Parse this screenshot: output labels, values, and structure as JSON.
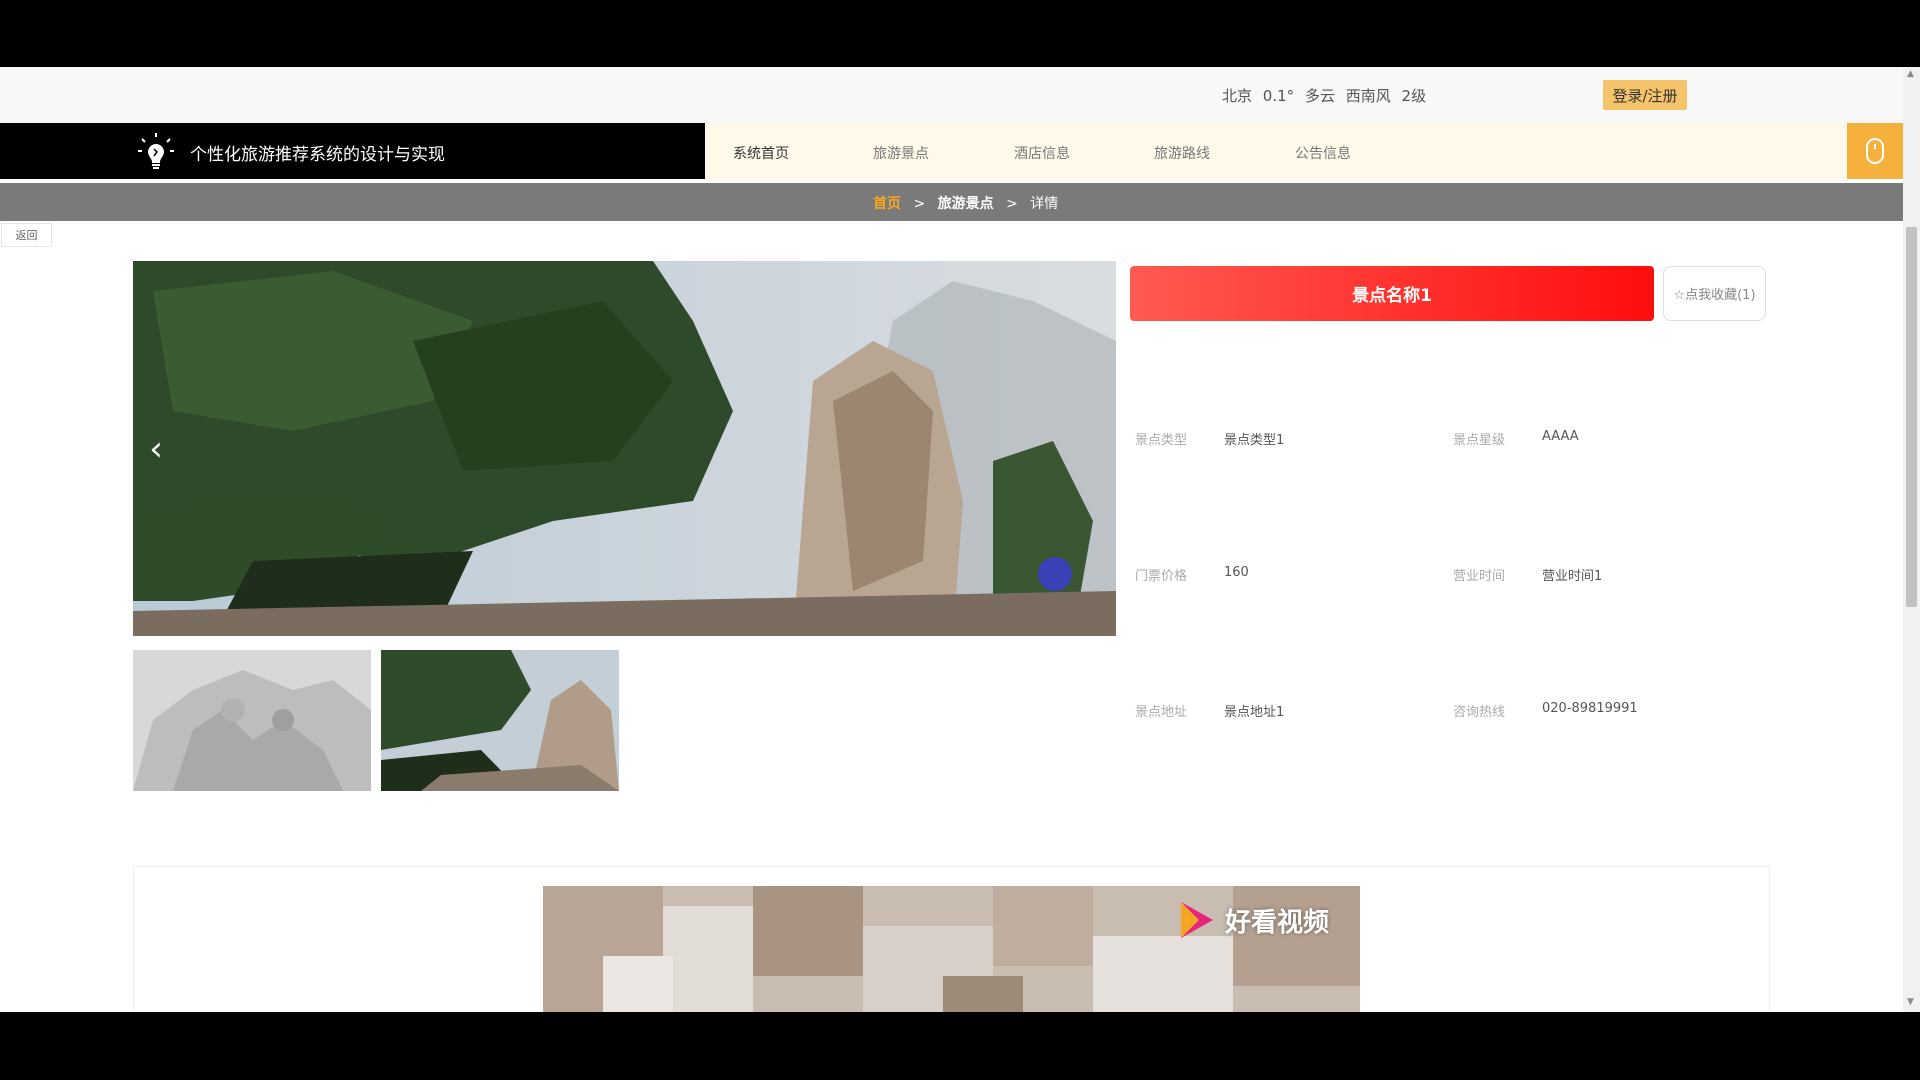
{
  "weather": {
    "city": "北京",
    "temp": "0.1°",
    "condition": "多云",
    "wind": "西南风",
    "level": "2级"
  },
  "auth": {
    "login_label": "登录/注册"
  },
  "brand": {
    "title": "个性化旅游推荐系统的设计与实现"
  },
  "nav": {
    "items": [
      {
        "label": "系统首页"
      },
      {
        "label": "旅游景点"
      },
      {
        "label": "酒店信息"
      },
      {
        "label": "旅游路线"
      },
      {
        "label": "公告信息"
      }
    ]
  },
  "breadcrumb": {
    "home": "首页",
    "section": "旅游景点",
    "current": "详情",
    "separator": ">"
  },
  "back_label": "返回",
  "carousel": {
    "prev_icon": "‹"
  },
  "detail": {
    "name": "景点名称1",
    "favorite_label": "☆点我收藏(1)",
    "fields": [
      {
        "label": "景点类型",
        "value": "景点类型1"
      },
      {
        "label": "景点星级",
        "value": "AAAA"
      },
      {
        "label": "门票价格",
        "value": "160"
      },
      {
        "label": "营业时间",
        "value": "营业时间1"
      },
      {
        "label": "景点地址",
        "value": "景点地址1"
      },
      {
        "label": "咨询热线",
        "value": "020-89819991"
      }
    ]
  },
  "video": {
    "watermark": "好看视频"
  },
  "colors": {
    "accent": "#f5b13c",
    "banner": "#ff1a1a",
    "crumb_home": "#f5a623"
  }
}
